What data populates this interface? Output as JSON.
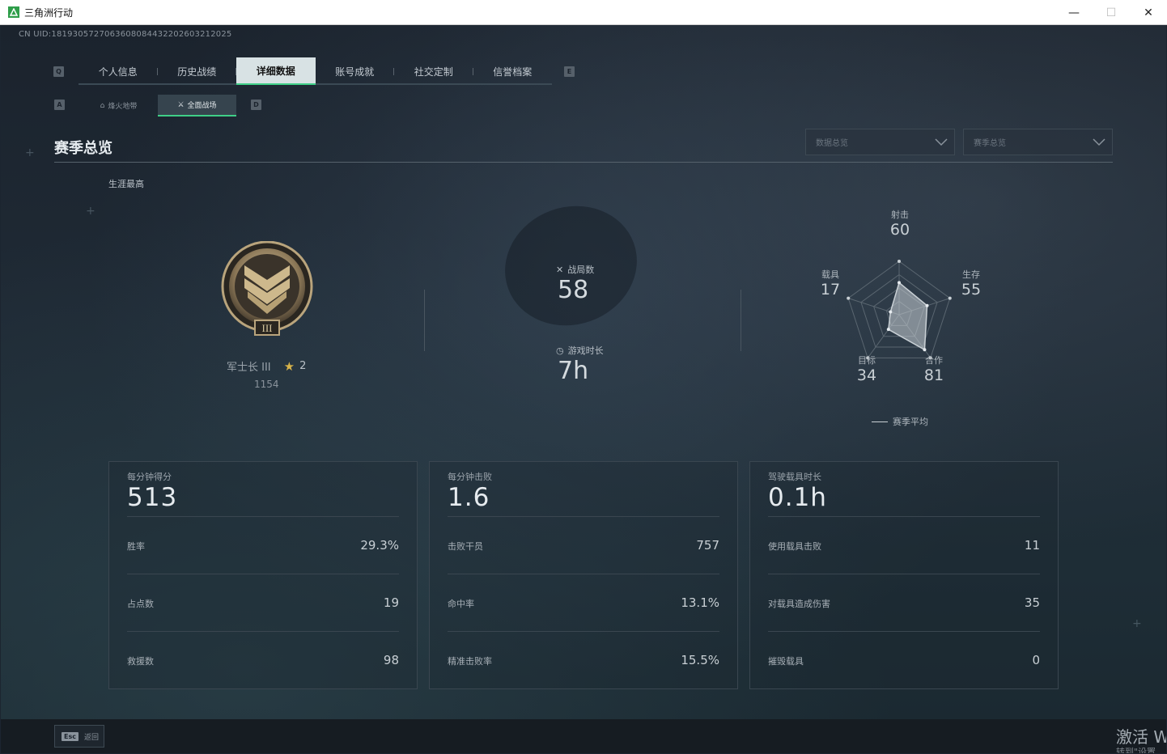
{
  "window": {
    "title": "三角洲行动",
    "minimize": "—",
    "maximize": "☐",
    "close": "✕"
  },
  "uid": "CN UID:1819305727063608084432202603212025",
  "key_hints": {
    "tabs_left": "Q",
    "tabs_right": "E",
    "subtabs_left": "A",
    "subtabs_right": "D"
  },
  "tabs": [
    {
      "label": "个人信息",
      "active": false
    },
    {
      "label": "历史战绩",
      "active": false
    },
    {
      "label": "详细数据",
      "active": true
    },
    {
      "label": "账号成就",
      "active": false
    },
    {
      "label": "社交定制",
      "active": false
    },
    {
      "label": "信誉档案",
      "active": false
    }
  ],
  "subtabs": [
    {
      "label": "烽火地带",
      "icon": "flame-zone-icon",
      "active": false
    },
    {
      "label": "全面战场",
      "icon": "battlefield-icon",
      "active": true
    }
  ],
  "section": {
    "title": "赛季总览",
    "dropdown_data": "数据总览",
    "dropdown_season": "赛季总览",
    "career_label": "生涯最高"
  },
  "rank": {
    "name": "军士长 III",
    "stars": "2",
    "score": "1154",
    "badge_numeral": "III"
  },
  "middle_stats": {
    "matches_label": "战局数",
    "matches_value": "58",
    "playtime_label": "游戏时长",
    "playtime_value": "7h"
  },
  "radar": {
    "axes": [
      {
        "label": "射击",
        "value": "60"
      },
      {
        "label": "生存",
        "value": "55"
      },
      {
        "label": "合作",
        "value": "81"
      },
      {
        "label": "目标",
        "value": "34"
      },
      {
        "label": "载具",
        "value": "17"
      }
    ],
    "legend": "赛季平均",
    "fill_color": "#c9d0d5"
  },
  "cards": [
    {
      "head_label": "每分钟得分",
      "head_value": "513",
      "rows": [
        {
          "k": "胜率",
          "v": "29.3%"
        },
        {
          "k": "占点数",
          "v": "19"
        },
        {
          "k": "救援数",
          "v": "98"
        }
      ]
    },
    {
      "head_label": "每分钟击败",
      "head_value": "1.6",
      "rows": [
        {
          "k": "击败干员",
          "v": "757"
        },
        {
          "k": "命中率",
          "v": "13.1%"
        },
        {
          "k": "精准击败率",
          "v": "15.5%"
        }
      ]
    },
    {
      "head_label": "驾驶载具时长",
      "head_value": "0.1h",
      "rows": [
        {
          "k": "使用载具击败",
          "v": "11"
        },
        {
          "k": "对载具造成伤害",
          "v": "35"
        },
        {
          "k": "摧毁载具",
          "v": "0"
        }
      ]
    }
  ],
  "bottom": {
    "esc_key": "Esc",
    "esc_label": "返回",
    "activate_line1": "激活 W",
    "activate_line2": "转到\"设置"
  },
  "colors": {
    "accent": "#3fcf87",
    "star": "#d8b44a"
  }
}
